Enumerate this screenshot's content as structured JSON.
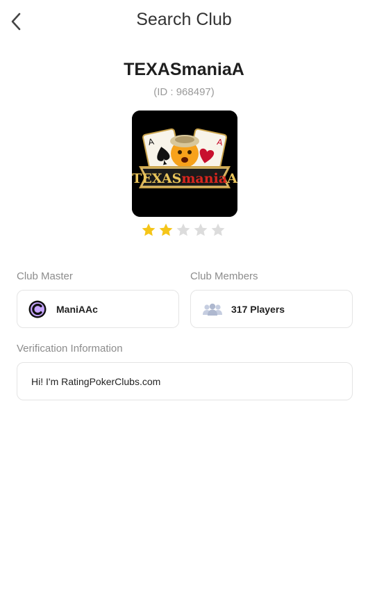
{
  "header": {
    "title": "Search Club",
    "back_icon": "chevron-left-icon"
  },
  "club": {
    "name": "TEXASmaniaA",
    "id_text": "(ID : 968497)",
    "rating": 2,
    "rating_max": 5,
    "logo_text": "TEXASmaniaA"
  },
  "master": {
    "label": "Club Master",
    "name": "ManiAAc",
    "avatar_icon": "club-master-avatar-icon"
  },
  "members": {
    "label": "Club Members",
    "count_text": "317 Players",
    "icon": "users-icon"
  },
  "verification": {
    "label": "Verification Information",
    "text": "Hi! I'm RatingPokerClubs.com"
  },
  "colors": {
    "star_active": "#f5c518",
    "star_inactive": "#dcdcdc",
    "label": "#8c8c8c",
    "border": "#e4e4e4"
  }
}
